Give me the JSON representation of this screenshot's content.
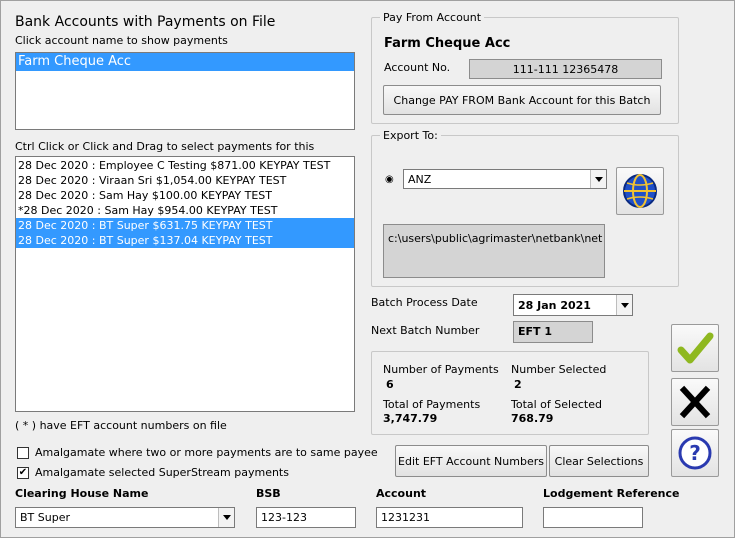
{
  "accounts_title": "Bank Accounts with Payments on File",
  "accounts_hint": "Click account name to show payments",
  "accounts": [
    "Farm Cheque Acc"
  ],
  "payments_hint": "Ctrl Click or Click and Drag to select payments for this",
  "payments": [
    {
      "text": "28 Dec 2020 : Employee C Testing $871.00 KEYPAY TEST",
      "selected": false
    },
    {
      "text": "28 Dec 2020 : Viraan Sri $1,054.00 KEYPAY TEST",
      "selected": false
    },
    {
      "text": "28 Dec 2020 : Sam Hay $100.00 KEYPAY TEST",
      "selected": false
    },
    {
      "text": "*28 Dec 2020 : Sam Hay $954.00 KEYPAY TEST",
      "selected": false
    },
    {
      "text": "28 Dec 2020 : BT Super $631.75 KEYPAY TEST",
      "selected": true
    },
    {
      "text": "28 Dec 2020 : BT Super $137.04 KEYPAY TEST",
      "selected": true
    }
  ],
  "eft_note": "( * )  have EFT account numbers on file",
  "amalgamate_payee": {
    "label": "Amalgamate where two or more payments are to same payee",
    "checked": false
  },
  "amalgamate_super": {
    "label": "Amalgamate selected SuperStream payments",
    "checked": true
  },
  "pay_from": {
    "group_title": "Pay From Account",
    "account_name": "Farm Cheque Acc",
    "account_no_label": "Account No.",
    "account_no": "111-111 12365478",
    "change_button": "Change PAY FROM Bank Account for this Batch"
  },
  "export_to": {
    "group_title": "Export To:",
    "bank": "ANZ",
    "path": "c:\\users\\public\\agrimaster\\netbank\\net"
  },
  "batch": {
    "date_label": "Batch Process Date",
    "date_value": "28  Jan  2021",
    "next_label": "Next Batch Number",
    "next_value": "EFT 1"
  },
  "summary": {
    "num_payments_label": "Number of Payments",
    "num_payments": "6",
    "num_selected_label": "Number Selected",
    "num_selected": "2",
    "total_payments_label": "Total of Payments",
    "total_payments": "3,747.79",
    "total_selected_label": "Total of Selected",
    "total_selected": "768.79"
  },
  "buttons": {
    "edit_eft": "Edit EFT Account Numbers",
    "clear": "Clear Selections"
  },
  "bottom": {
    "clearing_house_label": "Clearing House Name",
    "clearing_house": "BT Super",
    "bsb_label": "BSB",
    "bsb": "123-123",
    "account_label": "Account",
    "account": "1231231",
    "lodgement_label": "Lodgement Reference",
    "lodgement": ""
  },
  "colors": {
    "selection": "#3399ff",
    "ok_check": "#8fb820"
  }
}
